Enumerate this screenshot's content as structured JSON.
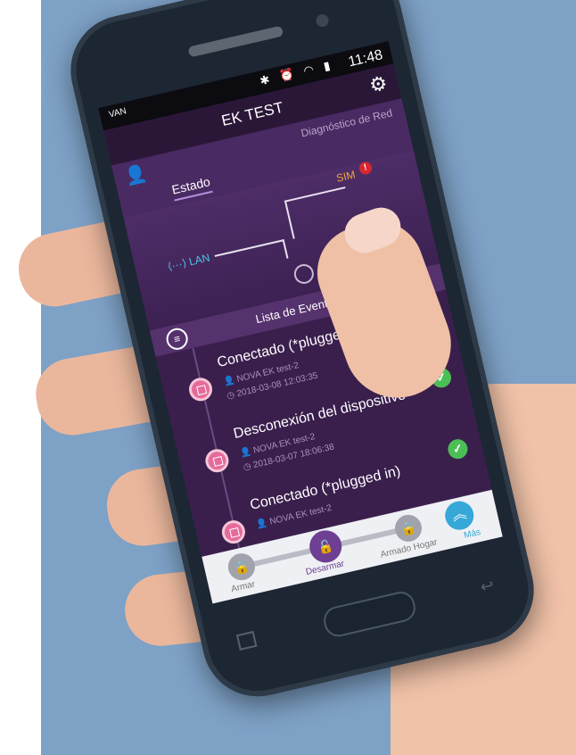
{
  "colors": {
    "background": "#7ea1c6",
    "app_primary": "#3a1f4d",
    "accent_purple": "#6e3f93",
    "success_green": "#4bbf56",
    "sim_orange": "#f0a838",
    "lan_blue": "#4fc4e8",
    "more_blue": "#35a8d8"
  },
  "status_bar": {
    "left_text": "VAN",
    "time": "11:48",
    "icons": [
      "bluetooth-icon",
      "alarm-icon",
      "wifi-icon",
      "signal-icon",
      "battery-icon"
    ]
  },
  "app_bar": {
    "title": "EK TEST",
    "settings_icon": "gear-icon"
  },
  "tabs": {
    "items": [
      {
        "label": "Estado",
        "active": true
      },
      {
        "label": "Diagnóstico de Red",
        "active": false
      }
    ],
    "user_icon": "user-icon"
  },
  "diagram": {
    "sim_label": "SIM",
    "sim_alert": "!",
    "lan_label": "LAN"
  },
  "events": {
    "header": "Lista de Eventos",
    "items": [
      {
        "title": "Conectado (*plugged in)",
        "device": "NOVA EK test-2",
        "timestamp": "2018-03-08 12:03:35",
        "status": "ok"
      },
      {
        "title": "Desconexión del dispositivo",
        "device": "NOVA EK test-2",
        "timestamp": "2018-03-07 18:06:38",
        "status": "ok"
      },
      {
        "title": "Conectado (*plugged in)",
        "device": "NOVA EK test-2",
        "timestamp": "",
        "status": "ok"
      }
    ]
  },
  "bottom_nav": {
    "items": [
      {
        "label": "Armar",
        "icon": "lock-icon",
        "active": false
      },
      {
        "label": "Desarmar",
        "icon": "unlock-icon",
        "active": true
      },
      {
        "label": "Armado Hogar",
        "icon": "home-lock-icon",
        "active": false
      },
      {
        "label": "Más",
        "icon": "chevron-up-icon",
        "active": false
      }
    ]
  }
}
